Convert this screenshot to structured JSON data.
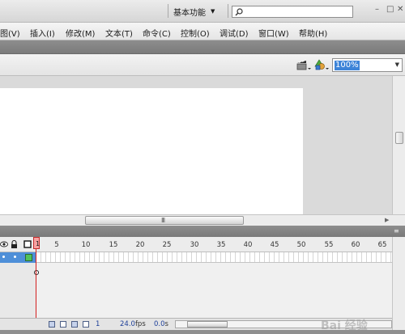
{
  "titlebar": {
    "workspace_label": "基本功能",
    "workspace_arrow": "▼",
    "search_placeholder": "",
    "window_controls": [
      "–",
      "□",
      "✕"
    ]
  },
  "menu": [
    {
      "label": "图(V)"
    },
    {
      "label": "插入(I)"
    },
    {
      "label": "修改(M)"
    },
    {
      "label": "文本(T)"
    },
    {
      "label": "命令(C)"
    },
    {
      "label": "控制(O)"
    },
    {
      "label": "调试(D)"
    },
    {
      "label": "窗口(W)"
    },
    {
      "label": "帮助(H)"
    }
  ],
  "editbar": {
    "zoom_value": "100%",
    "icons": [
      "edit-scene-icon",
      "edit-symbols-icon"
    ]
  },
  "scrollbar": {
    "grip": "III"
  },
  "timeline": {
    "header_icons": [
      "eye-icon",
      "lock-icon",
      "outline-icon"
    ],
    "ruler": [
      "1",
      "5",
      "10",
      "15",
      "20",
      "25",
      "30",
      "35",
      "40",
      "45",
      "50",
      "55",
      "60",
      "65"
    ],
    "current_frame": "1",
    "fps": "24.0",
    "fps_unit": "fps",
    "time": "0.0",
    "time_unit": "s"
  },
  "watermark": "Bai 经验",
  "colors": {
    "layer_selected": "#4e8fd8",
    "playhead": "#d42020",
    "zoom_highlight": "#3d84d8"
  }
}
